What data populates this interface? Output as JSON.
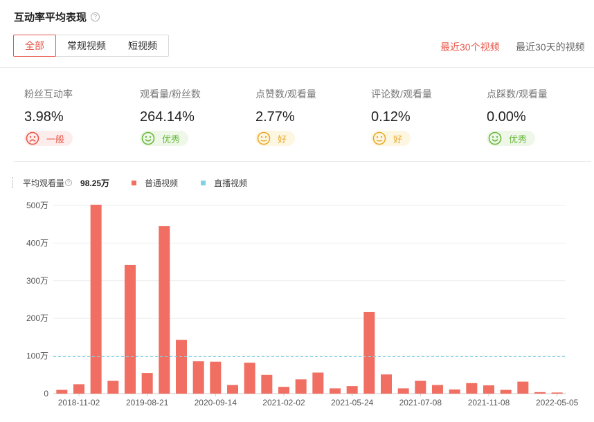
{
  "header": {
    "title": "互动率平均表现",
    "help": "?"
  },
  "tabs": [
    {
      "label": "全部",
      "active": true
    },
    {
      "label": "常规视频",
      "active": false
    },
    {
      "label": "短视频",
      "active": false
    }
  ],
  "ranges": [
    {
      "label": "最近30个视频",
      "active": true
    },
    {
      "label": "最近30天的视频",
      "active": false
    }
  ],
  "metrics": [
    {
      "label": "粉丝互动率",
      "value": "3.98%",
      "rating": "一般",
      "level": "poor"
    },
    {
      "label": "观看量/粉丝数",
      "value": "264.14%",
      "rating": "优秀",
      "level": "great"
    },
    {
      "label": "点赞数/观看量",
      "value": "2.77%",
      "rating": "好",
      "level": "good"
    },
    {
      "label": "评论数/观看量",
      "value": "0.12%",
      "rating": "好",
      "level": "good"
    },
    {
      "label": "点踩数/观看量",
      "value": "0.00%",
      "rating": "优秀",
      "level": "great"
    }
  ],
  "legend": {
    "avg_label": "平均观看量",
    "avg_value": "98.25万",
    "series1": "普通视频",
    "series2": "直播视频"
  },
  "colors": {
    "accent": "#e8584a",
    "bar": "#f06e62",
    "live": "#7fd3e6",
    "great": "#6ab93d",
    "good": "#e9aa2a",
    "poor": "#e8584a"
  },
  "chart_data": {
    "type": "bar",
    "y_tick_labels": [
      "0",
      "100万",
      "200万",
      "300万",
      "400万",
      "500万"
    ],
    "ylim": [
      0,
      5000000
    ],
    "y_ticks": [
      0,
      1000000,
      2000000,
      3000000,
      4000000,
      5000000
    ],
    "x_tick_labels": [
      "2018-11-02",
      "2019-08-21",
      "2020-09-14",
      "2021-02-02",
      "2021-05-24",
      "2021-07-08",
      "2021-11-08",
      "2022-05-05"
    ],
    "x_tick_indices": [
      1,
      5,
      9,
      13,
      17,
      21,
      25,
      29
    ],
    "average": 982500,
    "series": [
      {
        "name": "普通视频",
        "values": [
          100000,
          250000,
          5020000,
          340000,
          3420000,
          550000,
          4450000,
          1430000,
          860000,
          850000,
          230000,
          820000,
          500000,
          180000,
          380000,
          560000,
          140000,
          200000,
          2170000,
          510000,
          140000,
          340000,
          230000,
          110000,
          280000,
          220000,
          100000,
          320000,
          40000,
          30000
        ]
      }
    ],
    "grid": true,
    "legend_position": "top-left"
  }
}
